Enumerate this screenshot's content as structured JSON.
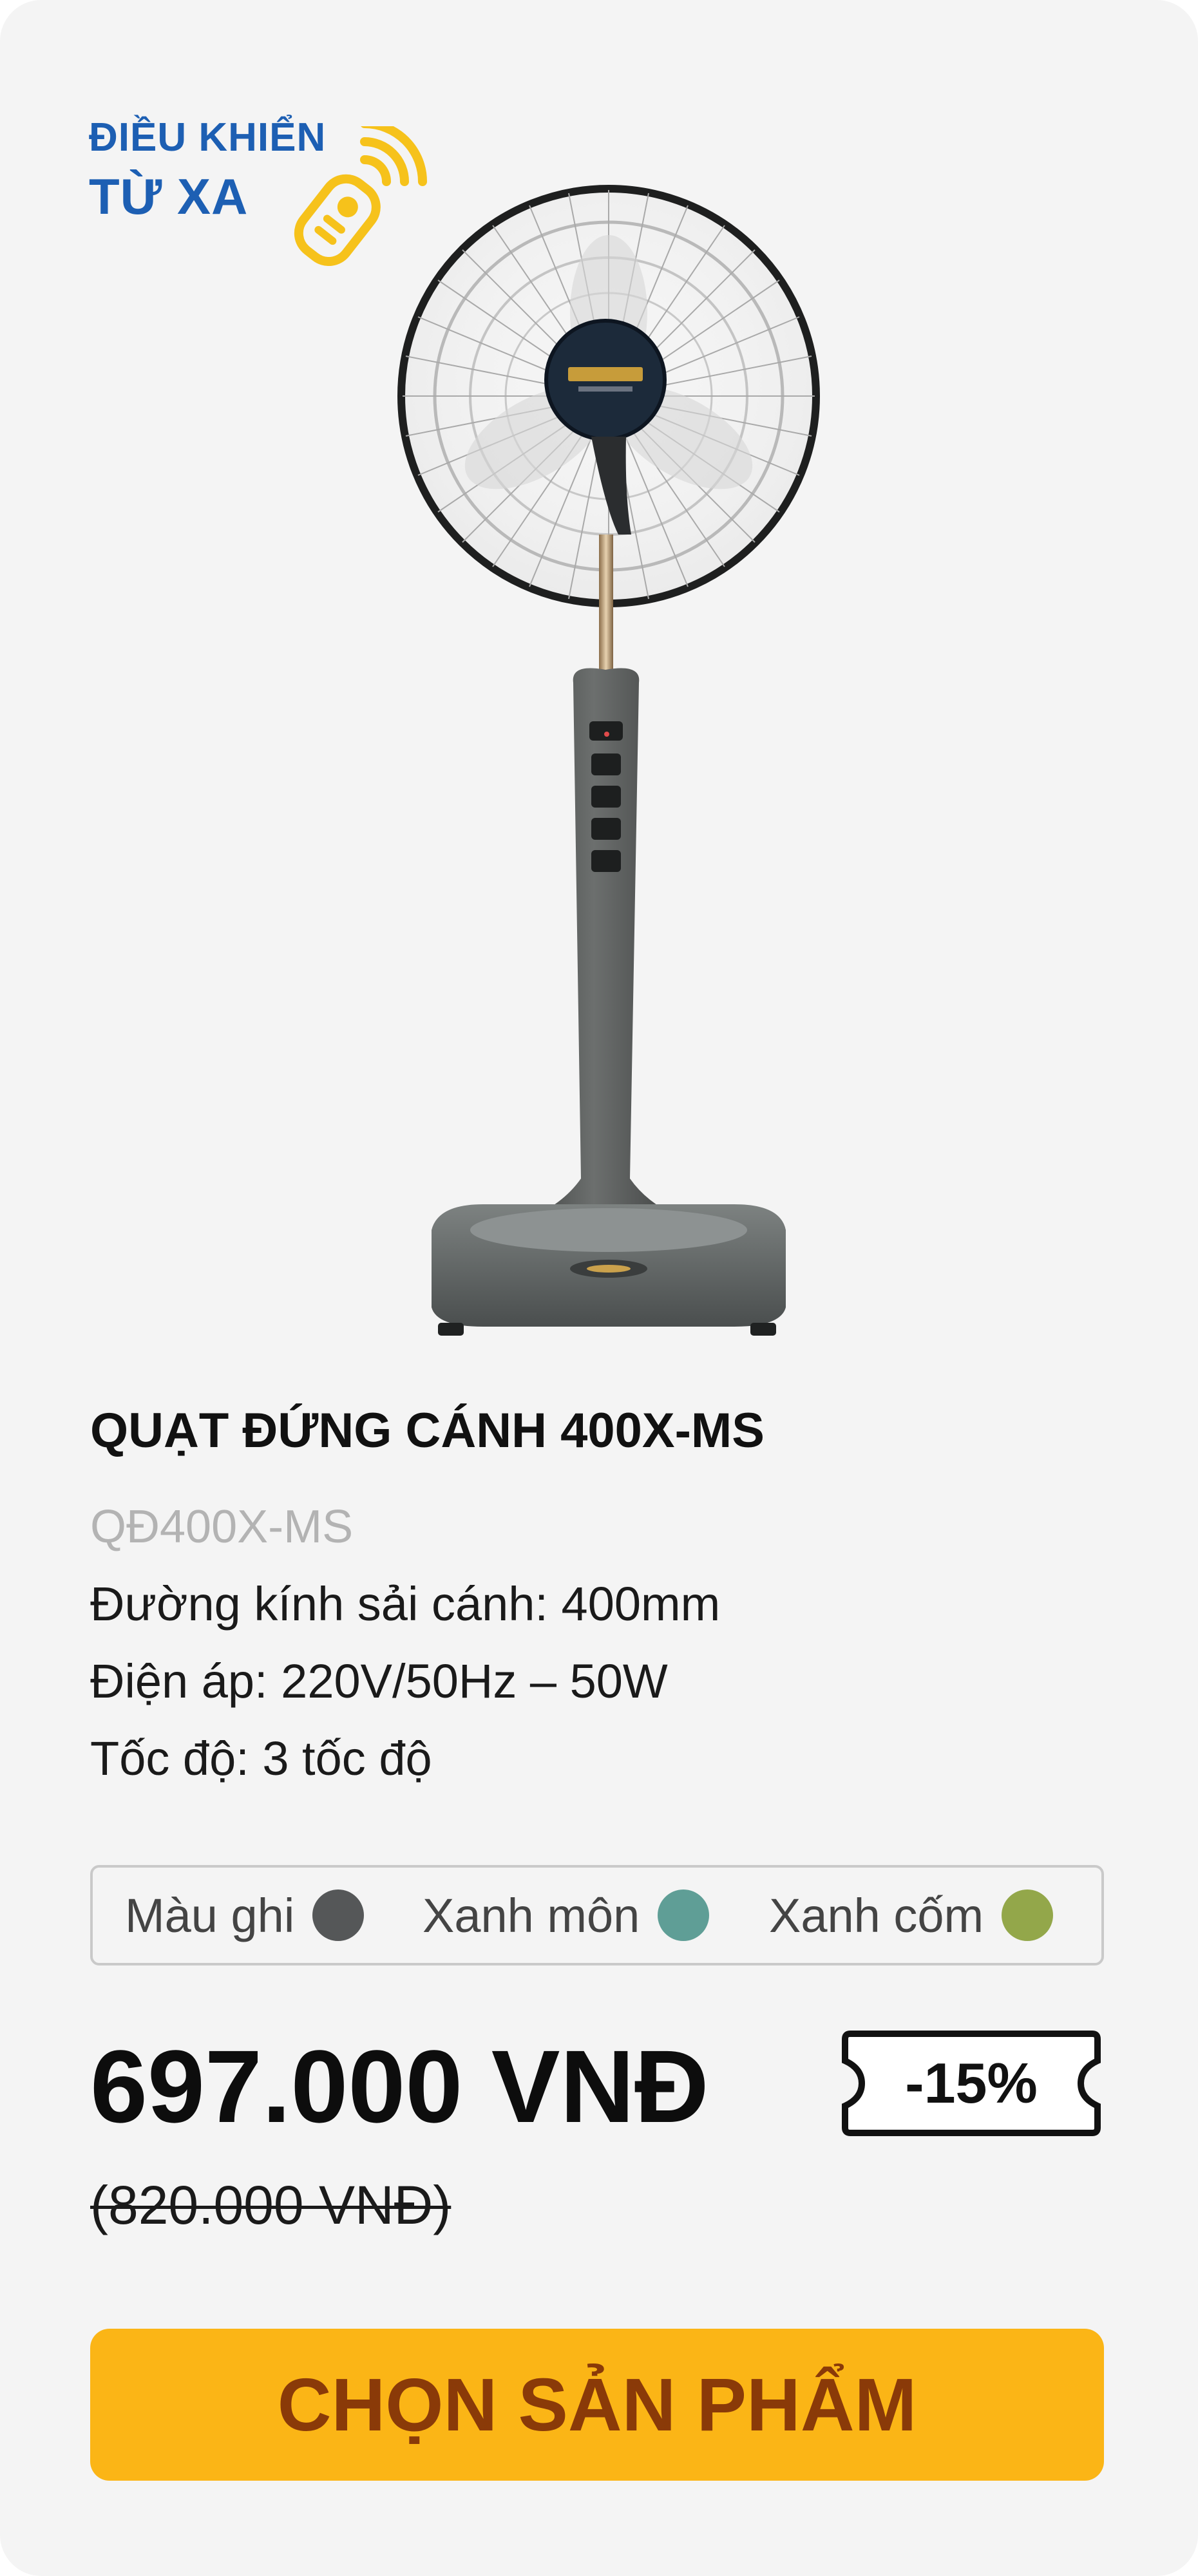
{
  "badge": {
    "line1": "ĐIỀU KHIỂN",
    "line2": "TỪ XA",
    "icon": "remote-control-icon",
    "color": "#1d5fb3",
    "icon_color": "#f6c21b"
  },
  "product": {
    "image_icon": "standing-fan-image",
    "title": "QUẠT ĐỨNG CÁNH 400X-MS",
    "sku": "QĐ400X-MS",
    "specs": [
      "Đường kính sải cánh: 400mm",
      "Điện áp: 220V/50Hz – 50W",
      "Tốc độ: 3 tốc độ"
    ]
  },
  "colors": [
    {
      "label": "Màu ghi",
      "swatch": "#555758"
    },
    {
      "label": "Xanh môn",
      "swatch": "#5f9e96"
    },
    {
      "label": "Xanh cốm",
      "swatch": "#93a74a"
    }
  ],
  "pricing": {
    "price": "697.000 VNĐ",
    "discount": "-15%",
    "old_price": "(820.000 VNĐ)"
  },
  "cta": {
    "label": "CHỌN SẢN PHẨM",
    "background": "#fbb516",
    "text_color": "#8a3a08"
  }
}
